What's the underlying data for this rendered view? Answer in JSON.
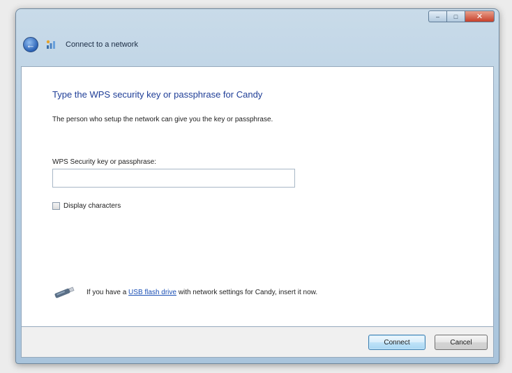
{
  "window": {
    "caption_buttons": {
      "minimize": "–",
      "maximize": "□",
      "close": "✕"
    }
  },
  "nav": {
    "title": "Connect to a network",
    "back_icon": "back-arrow-icon",
    "app_icon": "network-icon"
  },
  "content": {
    "heading": "Type the WPS security key or passphrase for Candy",
    "description": "The person who setup the network can give you the key or passphrase.",
    "field_label": "WPS Security key or passphrase:",
    "field_value": "",
    "display_characters_label": "Display characters",
    "display_characters_checked": false,
    "usb_prefix": "If you have a ",
    "usb_link": "USB flash drive",
    "usb_suffix": " with network settings for Candy, insert it now.",
    "usb_icon": "usb-drive-icon"
  },
  "buttons": {
    "connect": "Connect",
    "cancel": "Cancel"
  },
  "colors": {
    "heading": "#1f3e97",
    "link": "#1a4fb5",
    "titlebar": "#b7cfe3"
  }
}
